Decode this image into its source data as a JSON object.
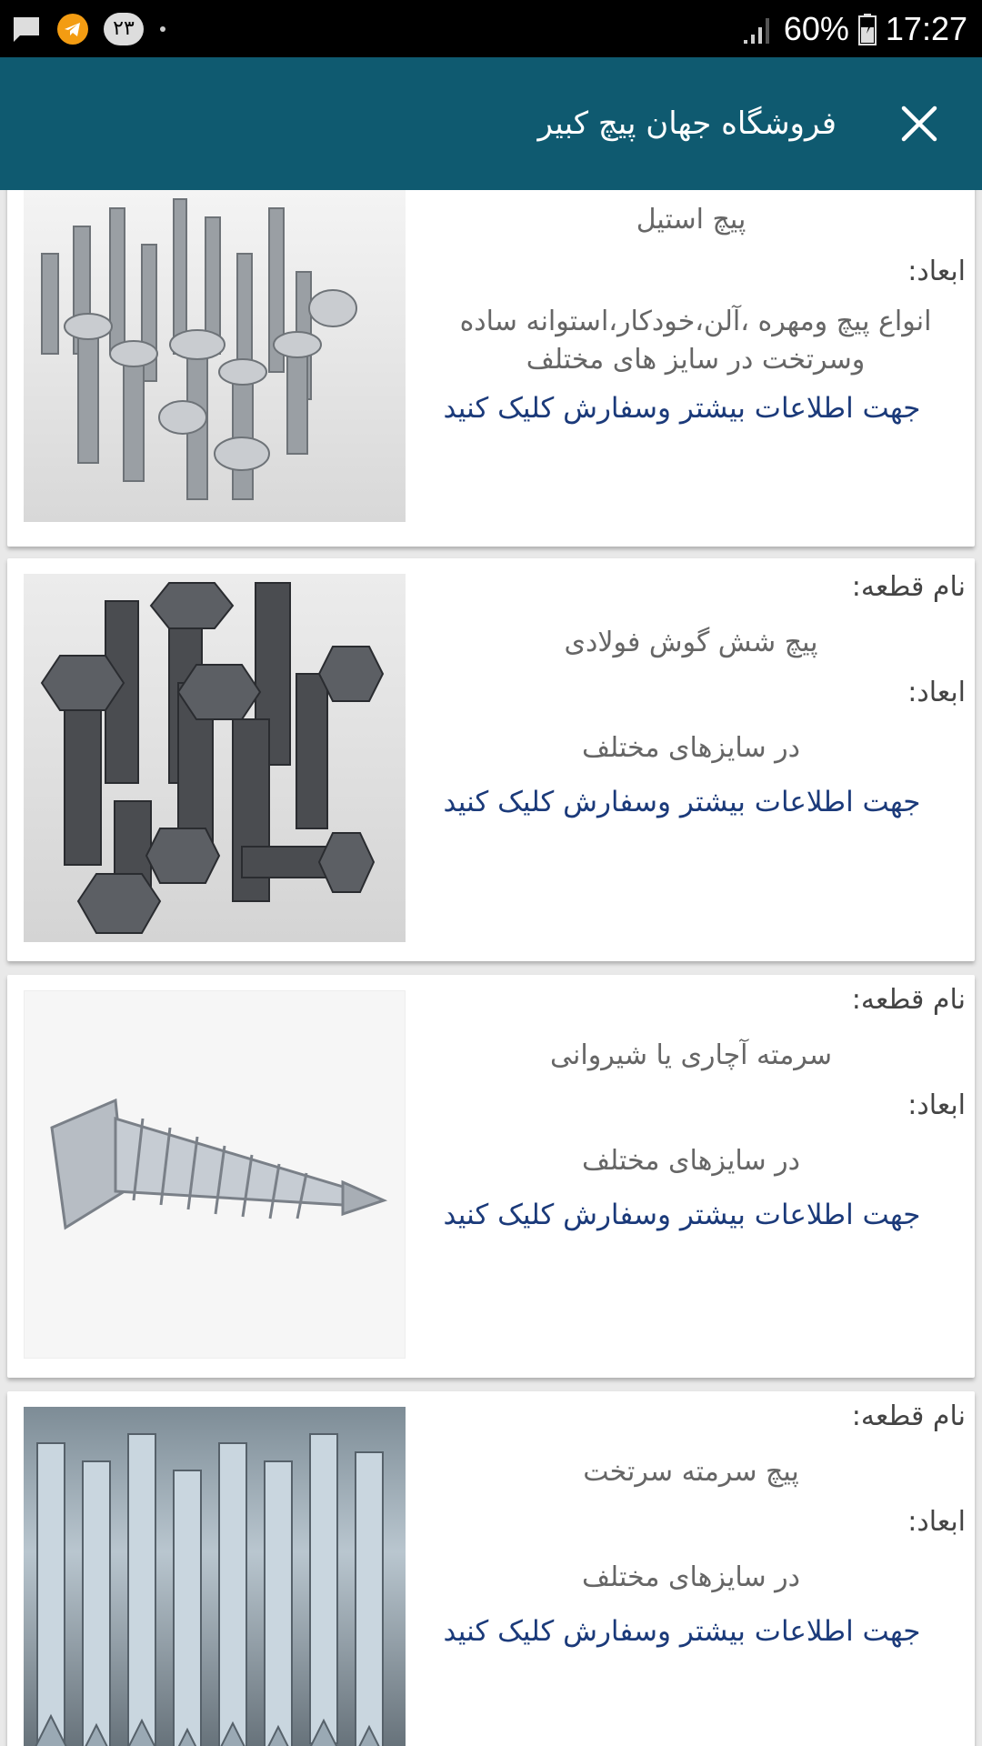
{
  "status_bar": {
    "notification_count": "۲۳",
    "battery": "60%",
    "time": "17:27",
    "icons": [
      "message-icon",
      "telegram-icon",
      "badge-icon",
      "dot-icon",
      "signal-icon",
      "battery-icon"
    ]
  },
  "app_bar": {
    "title": "فروشگاه جهان پیچ کبیر",
    "close_icon": "close-icon",
    "color": "#0f5a70"
  },
  "products": [
    {
      "name_label": "",
      "name": "پیچ استیل",
      "dims_label": "ابعاد:",
      "dims": "انواع پیچ ومهره ،آلن،خودکار،استوانه ساده وسرتخت در سایز های مختلف",
      "link": "جهت اطلاعات بیشتر وسفارش کلیک کنید"
    },
    {
      "name_label": "نام قطعه:",
      "name": "پیچ شش گوش فولادی",
      "dims_label": "ابعاد:",
      "dims": "در سایزهای مختلف",
      "link": "جهت اطلاعات بیشتر وسفارش کلیک کنید"
    },
    {
      "name_label": "نام قطعه:",
      "name": "سرمته آچاری یا شیروانی",
      "dims_label": "ابعاد:",
      "dims": "در سایزهای مختلف",
      "link": "جهت اطلاعات بیشتر وسفارش کلیک کنید"
    },
    {
      "name_label": "نام قطعه:",
      "name": "پیچ سرمته سرتخت",
      "dims_label": "ابعاد:",
      "dims": "در سایزهای مختلف",
      "link": "جهت اطلاعات بیشتر وسفارش کلیک کنید"
    }
  ]
}
